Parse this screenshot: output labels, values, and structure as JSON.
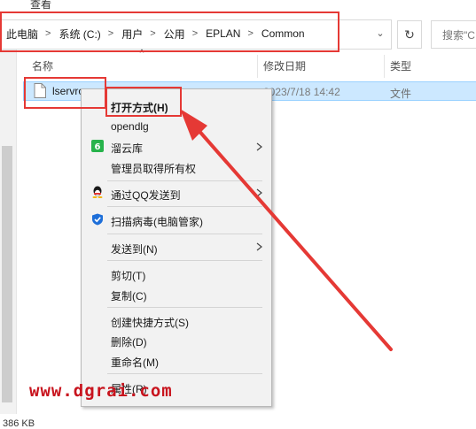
{
  "ribbon": {
    "view_tab": "查看"
  },
  "address_bar": {
    "crumbs": [
      "此电脑",
      "系统 (C:)",
      "用户",
      "公用",
      "EPLAN",
      "Common"
    ],
    "dropdown_glyph": "⌄",
    "refresh_glyph": "↻"
  },
  "search": {
    "placeholder": "搜索\"C"
  },
  "columns": {
    "sort_glyph": "^",
    "name": "名称",
    "date": "修改日期",
    "type": "类型"
  },
  "file": {
    "name": "lservrc",
    "date": "2023/7/18 14:42",
    "type": "文件"
  },
  "context_menu": {
    "items": [
      {
        "label": "打开方式(H)",
        "bold": true
      },
      {
        "label": "opendlg"
      },
      {
        "label": "溜云库",
        "icon": "liuyunku-icon",
        "submenu": true
      },
      {
        "label": "管理员取得所有权"
      },
      {
        "label": "通过QQ发送到",
        "icon": "qq-icon",
        "submenu": true
      },
      {
        "label": "扫描病毒(电脑管家)",
        "icon": "shield-icon"
      },
      {
        "label": "发送到(N)",
        "submenu": true
      },
      {
        "label": "剪切(T)"
      },
      {
        "label": "复制(C)"
      },
      {
        "label": "创建快捷方式(S)"
      },
      {
        "label": "删除(D)"
      },
      {
        "label": "重命名(M)"
      },
      {
        "label": "属性(R)"
      }
    ]
  },
  "status_bar": {
    "size_text": "386 KB"
  },
  "watermark": {
    "text": "www.dgrai.com"
  },
  "colors": {
    "annotation_red": "#e53935",
    "selection_blue": "#cce8ff",
    "watermark_red": "#c8141e"
  }
}
